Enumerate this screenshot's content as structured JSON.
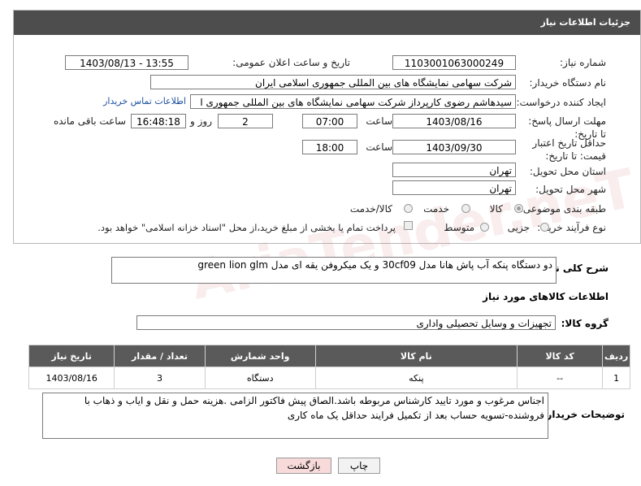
{
  "header": {
    "title": "جزئیات اطلاعات نیاز"
  },
  "form": {
    "need_number_label": "شماره نیاز:",
    "need_number": "1103001063000249",
    "announce_label": "تاریخ و ساعت اعلان عمومی:",
    "announce_value": "1403/08/13 - 13:55",
    "buyer_label": "نام دستگاه خریدار:",
    "buyer_value": "شرکت سهامی نمایشگاه های بین المللی جمهوری اسلامی ایران",
    "creator_label": "ایجاد کننده درخواست:",
    "creator_value": "سیدهاشم رضوی کارپرداز شرکت سهامی نمایشگاه های بین المللی جمهوری ا",
    "contact_link": "اطلاعات تماس خریدار",
    "deadline_label": "مهلت ارسال پاسخ: تا تاریخ:",
    "deadline_date": "1403/08/16",
    "time_label": "ساعت",
    "deadline_time": "07:00",
    "days_value": "2",
    "days_label": "روز و",
    "remaining_time": "16:48:18",
    "remaining_label": "ساعت باقی مانده",
    "validity_label": "حداقل تاریخ اعتبار قیمت: تا تاریخ:",
    "validity_date": "1403/09/30",
    "validity_time": "18:00",
    "province_label": "استان محل تحویل:",
    "province_value": "تهران",
    "city_label": "شهر محل تحویل:",
    "city_value": "تهران",
    "category_label": "طبقه بندی موضوعی:",
    "category_options": [
      "کالا",
      "خدمت",
      "کالا/خدمت"
    ],
    "category_selected": "کالا",
    "process_label": "نوع فرآیند خرید :",
    "process_options": [
      "جزیی",
      "متوسط"
    ],
    "payment_note": "پرداخت تمام یا بخشی از مبلغ خرید،از محل \"اسناد خزانه اسلامی\" خواهد بود."
  },
  "description": {
    "label": "شرح کلی نیاز:",
    "value": "دو دستگاه پنکه آب پاش هانا مدل 30cf09 و یک میکروفن یقه ای مدل green lion glm"
  },
  "goods_section": {
    "title": "اطلاعات کالاهای مورد نیاز",
    "group_label": "گروه کالا:",
    "group_value": "تجهیزات و وسایل تحصیلی واداری"
  },
  "table": {
    "headers": [
      "ردیف",
      "کد کالا",
      "نام کالا",
      "واحد شمارش",
      "تعداد / مقدار",
      "تاریخ نیاز"
    ],
    "rows": [
      [
        "1",
        "--",
        "پنکه",
        "دستگاه",
        "3",
        "1403/08/16"
      ]
    ]
  },
  "buyer_notes": {
    "label": "توضیحات خریدار:",
    "value": "اجناس مرغوب و مورد تایید کارشناس  مربوطه باشد.الصاق پیش فاکتور الزامی .هزینه حمل و نقل و ایاب و ذهاب با فروشنده-تسویه حساب بعد از تکمیل فرایند حداقل یک ماه کاری"
  },
  "buttons": {
    "print": "چاپ",
    "back": "بازگشت"
  },
  "watermark": "AriaTender.neT",
  "colors": {
    "titlebar": "#4d4d4d",
    "link": "#1a4fa0",
    "back_button": "#f8dada"
  }
}
